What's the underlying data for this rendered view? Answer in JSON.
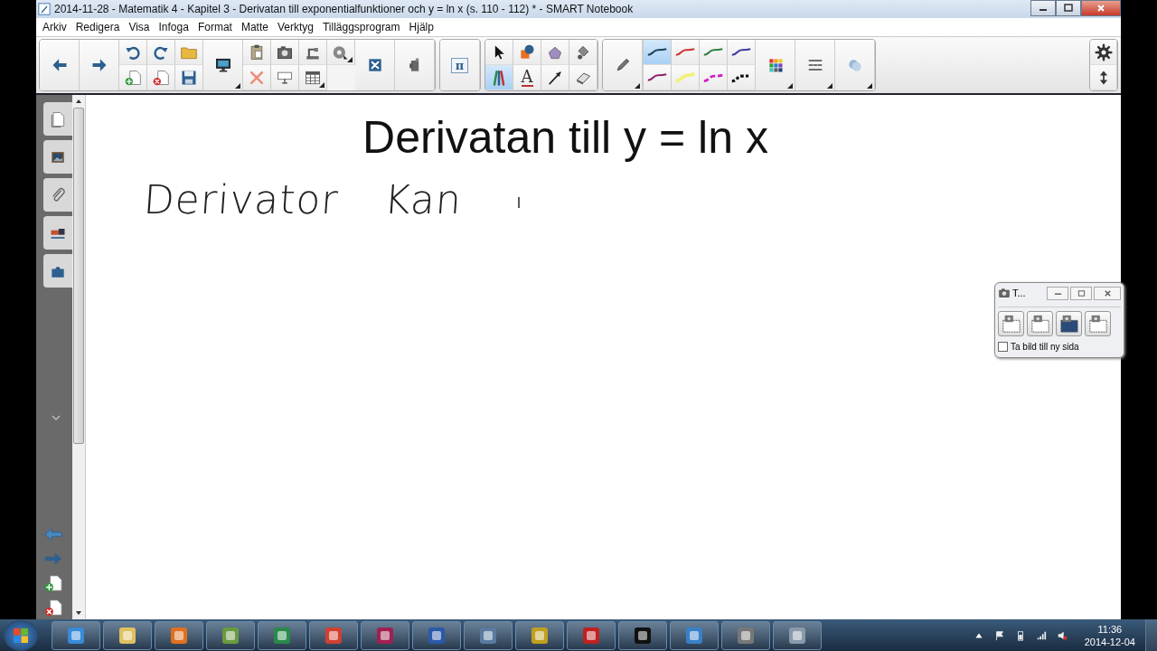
{
  "window": {
    "title": "2014-11-28 - Matematik 4 - Kapitel 3 - Derivatan till exponentialfunktioner och y = ln x (s. 110 - 112) * - SMART Notebook"
  },
  "menu": [
    "Arkiv",
    "Redigera",
    "Visa",
    "Infoga",
    "Format",
    "Matte",
    "Verktyg",
    "Tilläggsprogram",
    "Hjälp"
  ],
  "math_button": "π",
  "tools": [
    {
      "kind": "select",
      "selected": false
    },
    {
      "kind": "shapes",
      "selected": false
    },
    {
      "kind": "magic",
      "selected": false
    },
    {
      "kind": "bucket",
      "selected": false
    },
    {
      "kind": "pens",
      "selected": true
    },
    {
      "kind": "text",
      "glyph": "A",
      "selected": false
    },
    {
      "kind": "line",
      "selected": false
    },
    {
      "kind": "eraser",
      "selected": false
    }
  ],
  "pen_styles": [
    {
      "kind": "line",
      "color": "#1f3f5a",
      "selected": true
    },
    {
      "kind": "line",
      "color": "#d03030",
      "selected": false
    },
    {
      "kind": "line",
      "color": "#2f7f3f",
      "selected": false
    },
    {
      "kind": "line",
      "color": "#3a3aa0",
      "selected": false
    },
    {
      "kind": "line",
      "color": "#902070",
      "selected": false
    },
    {
      "kind": "highlighter",
      "color": "#f2f07a",
      "selected": false
    },
    {
      "kind": "dashed",
      "color": "#d020c0",
      "selected": false
    },
    {
      "kind": "dotted",
      "color": "#111111",
      "selected": false
    }
  ],
  "page": {
    "title": "Derivatan till y = ln x",
    "ink_words": [
      "Derivator",
      "Kan"
    ]
  },
  "capture_window": {
    "title": "T...",
    "checkbox": {
      "label": "Ta bild till ny sida",
      "checked": false
    }
  },
  "clock": {
    "time": "11:36",
    "date": "2014-12-04"
  }
}
